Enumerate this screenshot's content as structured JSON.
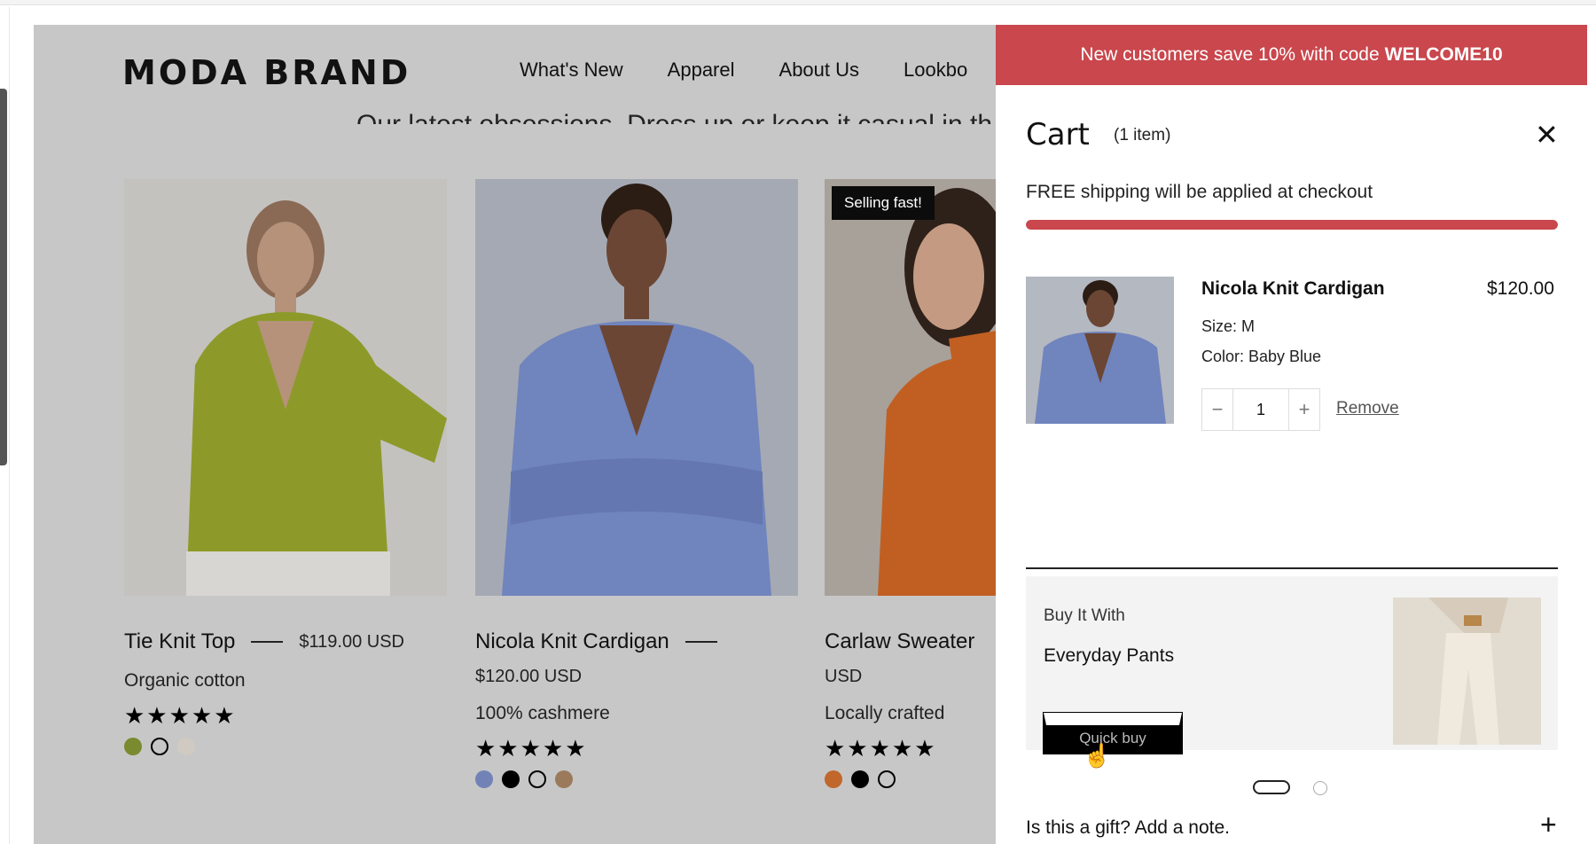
{
  "store": {
    "logo": "MODA BRAND",
    "nav": [
      "What's New",
      "Apparel",
      "About Us",
      "Lookbo"
    ],
    "tagline": "Our latest obsessions. Dress up or keep it casual in th",
    "products": [
      {
        "name": "Tie Knit Top",
        "price": "$119.00 USD",
        "subtitle": "Organic cotton",
        "stars": "★★★★★",
        "swatches": [
          "#7a8a2e",
          "#000000",
          "#d9d2c7"
        ],
        "selected_swatch": 1
      },
      {
        "name": "Nicola Knit Cardigan",
        "price": "$120.00 USD",
        "subtitle": "100% cashmere",
        "stars": "★★★★★",
        "swatches": [
          "#7183b6",
          "#000000",
          "#ffffff",
          "#9b7a5c"
        ],
        "selected_swatch": 2
      },
      {
        "name": "Carlaw Sweater",
        "price": "USD",
        "subtitle": "Locally crafted",
        "stars": "★★★★★",
        "badge": "Selling fast!",
        "swatches": [
          "#c1672b",
          "#000000",
          "#ffffff"
        ],
        "selected_swatch": 2
      }
    ]
  },
  "cart": {
    "promo_text": "New customers save 10% with code",
    "promo_code": "WELCOME10",
    "title": "Cart",
    "count": "(1 item)",
    "close_icon": "close-icon",
    "shipping_text": "FREE shipping will be applied at checkout",
    "shipping_progress": 1.0,
    "item": {
      "name": "Nicola Knit Cardigan",
      "price": "$120.00",
      "size": "Size: M",
      "color": "Color: Baby Blue",
      "quantity": "1",
      "minus": "−",
      "plus": "+",
      "remove": "Remove"
    },
    "upsell": {
      "label": "Buy It With",
      "name": "Everyday Pants",
      "button": "Quick buy"
    },
    "gift": {
      "label": "Is this a gift? Add a note.",
      "plus": "+"
    }
  },
  "colors": {
    "accent": "#c9474d",
    "overlay": "#c7c7c7"
  }
}
